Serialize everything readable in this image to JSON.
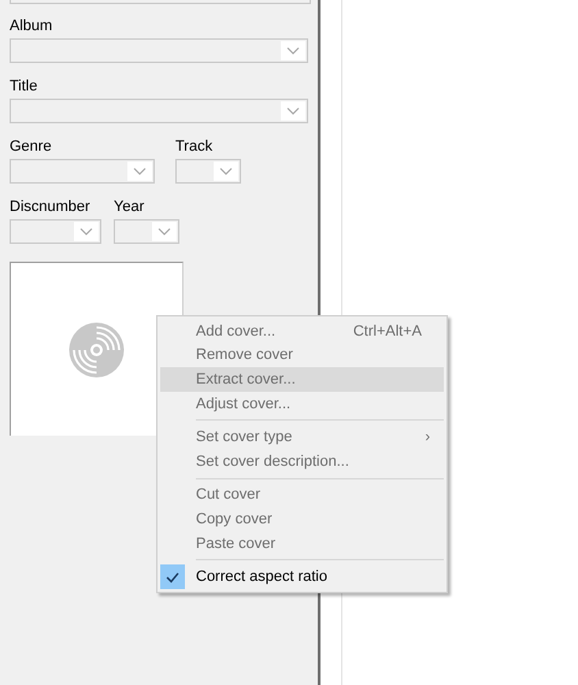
{
  "fields": [
    {
      "label": "Album",
      "kind": "wide"
    },
    {
      "label": "Title",
      "kind": "wide"
    },
    {
      "label": "Genre",
      "kind": "medium"
    },
    {
      "label": "Track",
      "kind": "small"
    },
    {
      "label": "Discnumber",
      "kind": "short"
    },
    {
      "label": "Year",
      "kind": "small"
    }
  ],
  "context_menu": {
    "items": [
      {
        "kind": "item",
        "label": "Add cover...",
        "shortcut": "Ctrl+Alt+A",
        "disabled": true,
        "selected": false
      },
      {
        "kind": "item",
        "label": "Remove cover",
        "disabled": true,
        "selected": false
      },
      {
        "kind": "item",
        "label": "Extract cover...",
        "disabled": true,
        "selected": true
      },
      {
        "kind": "item",
        "label": "Adjust cover...",
        "disabled": true,
        "selected": false
      },
      {
        "kind": "separator"
      },
      {
        "kind": "submenu",
        "label": "Set cover type",
        "arrow": "›",
        "disabled": true,
        "selected": false
      },
      {
        "kind": "item",
        "label": "Set cover description...",
        "disabled": true,
        "selected": false
      },
      {
        "kind": "separator"
      },
      {
        "kind": "item",
        "label": "Cut cover",
        "disabled": true,
        "selected": false
      },
      {
        "kind": "item",
        "label": "Copy cover",
        "disabled": true,
        "selected": false
      },
      {
        "kind": "item",
        "label": "Paste cover",
        "disabled": true,
        "selected": false
      },
      {
        "kind": "separator"
      },
      {
        "kind": "check",
        "label": "Correct aspect ratio",
        "checked": true,
        "disabled": false,
        "selected": false
      }
    ]
  }
}
